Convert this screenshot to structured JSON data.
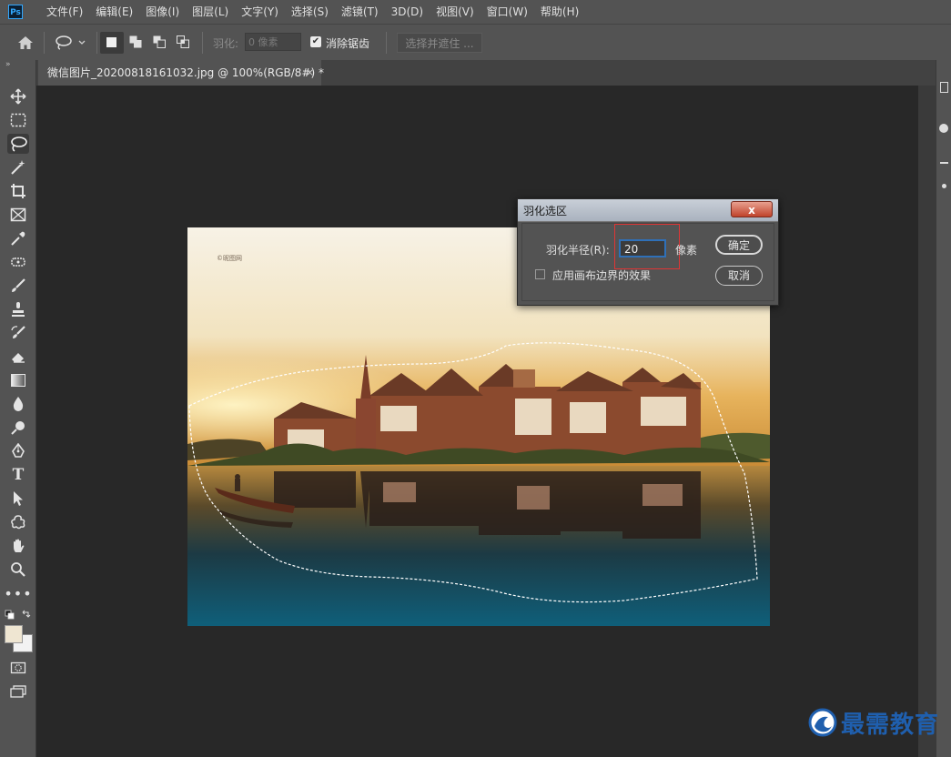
{
  "menu": {
    "logo": "Ps",
    "items": [
      "文件(F)",
      "编辑(E)",
      "图像(I)",
      "图层(L)",
      "文字(Y)",
      "选择(S)",
      "滤镜(T)",
      "3D(D)",
      "视图(V)",
      "窗口(W)",
      "帮助(H)"
    ]
  },
  "options": {
    "feather_label": "羽化:",
    "feather_value": "0 像素",
    "antialias_label": "消除锯齿",
    "antialias_checked": true,
    "select_mask_label": "选择并遮住 ..."
  },
  "document": {
    "tab_title": "微信图片_20200818161032.jpg @ 100%(RGB/8#) *",
    "close_glyph": "×",
    "photo_watermark": "©昵图网"
  },
  "dialog": {
    "title": "羽化选区",
    "close_glyph": "x",
    "radius_label": "羽化半径(R):",
    "radius_value": "20",
    "unit": "像素",
    "apply_canvas_label": "应用画布边界的效果",
    "apply_canvas_checked": false,
    "ok_label": "确定",
    "cancel_label": "取消"
  },
  "watermark": {
    "text": "最需教育"
  },
  "colors": {
    "ui_dark": "#535353",
    "canvas_bg": "#282828",
    "selection": "#ffffff",
    "highlight_red": "#e03535",
    "input_focus": "#2f70b8",
    "watermark_blue": "#1f5fae"
  }
}
